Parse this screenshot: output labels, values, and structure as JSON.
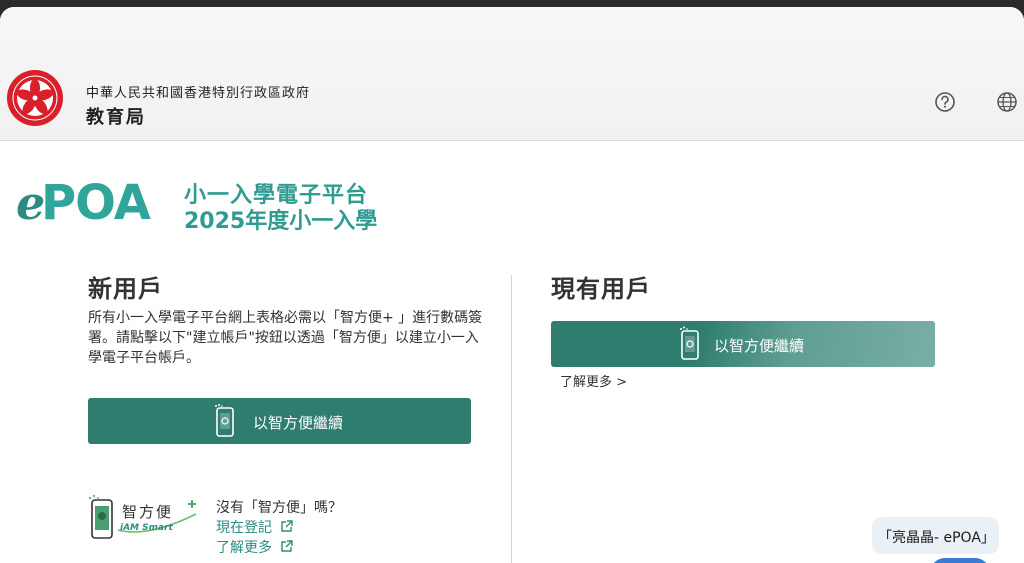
{
  "header": {
    "government_name": "中華人民共和國香港特別行政區政府",
    "bureau_name": "教育局",
    "help_icon": "help-circle-icon",
    "language_icon": "globe-icon"
  },
  "brand": {
    "logo_prefix": "e",
    "logo_main": "POA",
    "title_line1": "小一入學電子平台",
    "title_line2": "2025年度小一入學"
  },
  "new_user": {
    "title": "新用戶",
    "description": "所有小一入學電子平台網上表格必需以「智方便+ 」進行數碼簽署。請點擊以下\"建立帳戶\"按鈕以透過「智方便」以建立小一入學電子平台帳戶。",
    "continue_button": "以智方便繼續",
    "iam_smart_name": "智方便",
    "iam_smart_en": "iAM Smart",
    "no_app_question": "沒有「智方便」嗎？",
    "register_link": "現在登記",
    "learn_more_link": "了解更多"
  },
  "existing_user": {
    "title": "現有用戶",
    "continue_button": "以智方便繼續",
    "learn_more_link": "了解更多 >"
  },
  "toast": {
    "text": "「亮晶晶- ePOA」"
  },
  "colors": {
    "brand_teal": "#2fa59c",
    "button_green": "#2e7d6e",
    "link_teal": "#2e8b83"
  }
}
